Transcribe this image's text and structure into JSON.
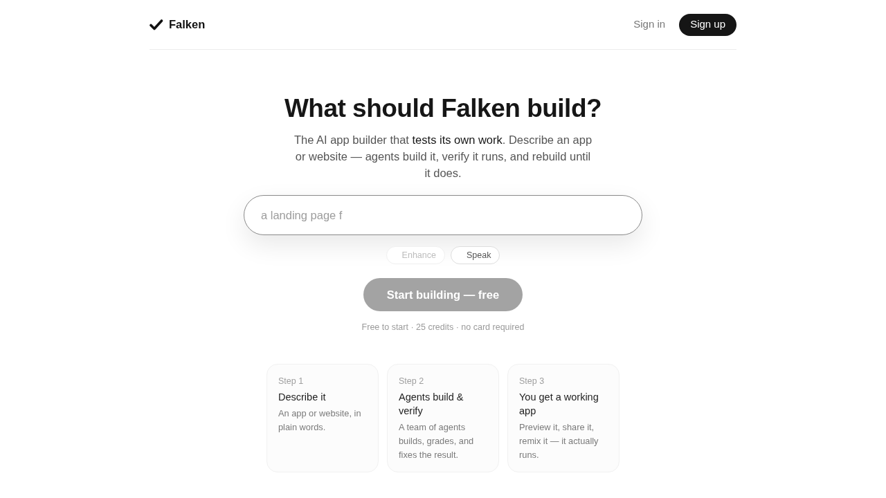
{
  "header": {
    "brand": "Falken",
    "sign_in": "Sign in",
    "sign_up": "Sign up"
  },
  "hero": {
    "title": "What should Falken build?",
    "subtitle": [
      {
        "text": "The AI app builder that ",
        "highlighted": false
      },
      {
        "text": "tests its own work",
        "highlighted": true
      },
      {
        "text": ". Describe an app or website — agents build it, verify it runs, and rebuild until it does.",
        "highlighted": false
      }
    ]
  },
  "prompt": {
    "placeholder": "a landing page f",
    "chips": [
      {
        "label": "Enhance",
        "disabled": true
      },
      {
        "label": "Speak",
        "disabled": false
      }
    ],
    "submit": {
      "label": "Start building — free",
      "disabled": true
    },
    "note": "Free to start · 25 credits · no card required"
  },
  "steps": [
    {
      "step": "Step 1",
      "title": "Describe it",
      "description": "An app or website, in plain words."
    },
    {
      "step": "Step 2",
      "title": "Agents build & verify",
      "description": "A team of agents builds, grades, and fixes the result."
    },
    {
      "step": "Step 3",
      "title": "You get a working app",
      "description": "Preview it, share it, remix it — it actually runs."
    }
  ]
}
